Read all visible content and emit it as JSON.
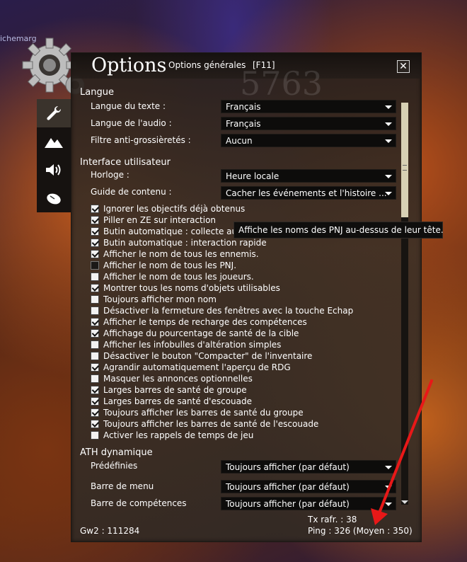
{
  "background": {
    "player_name": "ichemarg"
  },
  "window": {
    "title": "Options",
    "subtitle": "Options générales",
    "shortcut": "[F11]",
    "close_label": "✕",
    "watermark": "5763"
  },
  "sidebar": {
    "tabs": [
      {
        "icon": "wrench-icon",
        "active": true
      },
      {
        "icon": "mountains-icon",
        "active": false
      },
      {
        "icon": "speaker-icon",
        "active": false
      },
      {
        "icon": "mouse-icon",
        "active": false
      }
    ]
  },
  "langue": {
    "heading": "Langue",
    "rows": [
      {
        "label": "Langue du texte :",
        "value": "Français"
      },
      {
        "label": "Langue de l'audio :",
        "value": "Français"
      },
      {
        "label": "Filtre anti-grossièretés :",
        "value": "Aucun"
      }
    ]
  },
  "interface": {
    "heading": "Interface utilisateur",
    "rows": [
      {
        "label": "Horloge :",
        "value": "Heure locale"
      },
      {
        "label": "Guide de contenu :",
        "value": "Cacher les événements et l'histoire ..."
      }
    ],
    "checkboxes": [
      {
        "label": "Ignorer les objectifs déjà obtenus",
        "checked": true
      },
      {
        "label": "Piller en ZE sur interaction",
        "checked": true
      },
      {
        "label": "Butin automatique : collecte au",
        "checked": true
      },
      {
        "label": "Butin automatique : interaction rapide",
        "checked": true
      },
      {
        "label": "Afficher le nom de tous les ennemis.",
        "checked": true
      },
      {
        "label": "Afficher le nom de tous les PNJ.",
        "checked": false,
        "hover": true
      },
      {
        "label": "Afficher le nom de tous les joueurs.",
        "checked": false
      },
      {
        "label": "Montrer tous les noms d'objets utilisables",
        "checked": true
      },
      {
        "label": "Toujours afficher mon nom",
        "checked": false
      },
      {
        "label": "Désactiver la fermeture des fenêtres avec la touche Echap",
        "checked": false
      },
      {
        "label": "Afficher le temps de recharge des compétences",
        "checked": true
      },
      {
        "label": "Affichage du pourcentage de santé de la cible",
        "checked": true
      },
      {
        "label": "Afficher les infobulles d'altération simples",
        "checked": false
      },
      {
        "label": "Désactiver le bouton \"Compacter\" de l'inventaire",
        "checked": false
      },
      {
        "label": "Agrandir automatiquement l'aperçu de RDG",
        "checked": true
      },
      {
        "label": "Masquer les annonces optionnelles",
        "checked": false
      },
      {
        "label": "Larges barres de santé de groupe",
        "checked": true
      },
      {
        "label": "Larges barres de santé d'escouade",
        "checked": true
      },
      {
        "label": "Toujours afficher les barres de santé du groupe",
        "checked": true
      },
      {
        "label": "Toujours afficher les barres de santé de l'escouade",
        "checked": true
      },
      {
        "label": "Activer les rappels de temps de jeu",
        "checked": false
      }
    ]
  },
  "tooltip": {
    "text": "Affiche les noms des PNJ au-dessus de leur tête."
  },
  "ath": {
    "heading": "ATH dynamique",
    "rows": [
      {
        "label": "Prédéfinies",
        "value": "Toujours afficher (par défaut)"
      },
      {
        "label": "Barre de menu",
        "value": "Toujours afficher (par défaut)"
      },
      {
        "label": "Barre de compétences",
        "value": "Toujours afficher (par défaut)"
      }
    ]
  },
  "footer": {
    "build": "Gw2 : 111284",
    "refresh": "Tx rafr. : 38",
    "ping": "Ping : 326 (Moyen : 350)"
  },
  "colors": {
    "annotation_arrow": "#e81818",
    "panel_text": "#ffffff"
  }
}
